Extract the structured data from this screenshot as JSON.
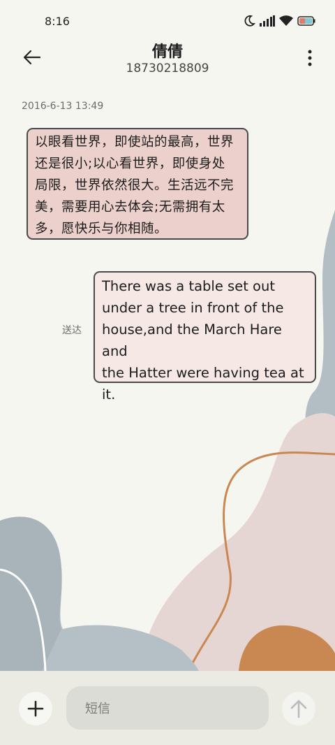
{
  "status_bar": {
    "time": "8:16",
    "icons": [
      "moon-icon",
      "signal-icon",
      "wifi-icon",
      "battery-icon"
    ]
  },
  "header": {
    "contact_name": "倩倩",
    "phone_number": "18730218809",
    "back_icon": "back-arrow-icon",
    "more_icon": "more-vertical-icon"
  },
  "conversation": {
    "timestamp": "2016-6-13 13:49",
    "messages": [
      {
        "direction": "incoming",
        "lines": [
          "以眼看世界，即使站的最高，世界",
          "还是很小;以心看世界，即使身处",
          "局限，世界依然很大。生活远不完",
          "美，需要用心去体会;无需拥有太",
          "多，愿快乐与你相随。"
        ]
      },
      {
        "direction": "outgoing",
        "lines": [
          "There was a table set out",
          "under a tree in front of the",
          "house,and the March Hare and",
          "the Hatter were having tea at",
          "it."
        ],
        "status": "送达"
      }
    ]
  },
  "composer": {
    "placeholder": "短信",
    "add_icon": "plus-icon",
    "send_icon": "send-arrow-icon"
  },
  "colors": {
    "background": "#f6f6f1",
    "incoming_bubble": "#ecd0cb",
    "outgoing_bubble": "#f6e8e5",
    "composer_bg": "#ebebe4",
    "accent_orange": "#c98752"
  }
}
